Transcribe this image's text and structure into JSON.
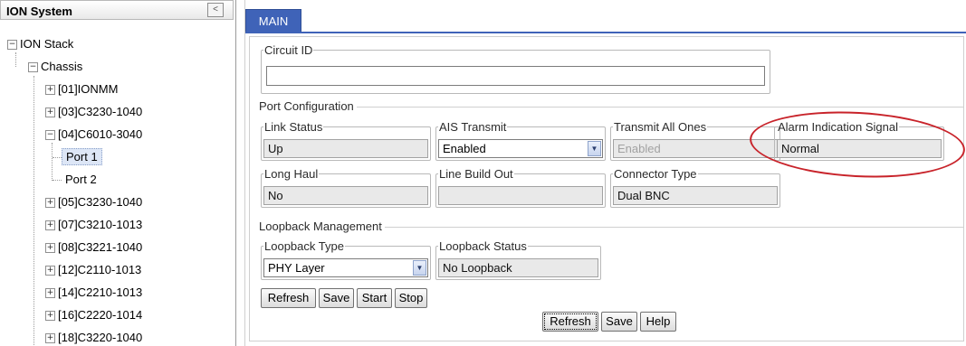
{
  "tree": {
    "title": "ION System",
    "collapse_glyph": "<",
    "root": "ION Stack",
    "chassis": "Chassis",
    "modules": [
      {
        "label": "[01]IONMM",
        "expander": "+"
      },
      {
        "label": "[03]C3230-1040",
        "expander": "+"
      },
      {
        "label": "[04]C6010-3040",
        "expander": "−"
      },
      {
        "label": "[05]C3230-1040",
        "expander": "+"
      },
      {
        "label": "[07]C3210-1013",
        "expander": "+"
      },
      {
        "label": "[08]C3221-1040",
        "expander": "+"
      },
      {
        "label": "[12]C2110-1013",
        "expander": "+"
      },
      {
        "label": "[14]C2210-1013",
        "expander": "+"
      },
      {
        "label": "[16]C2220-1014",
        "expander": "+"
      },
      {
        "label": "[18]C3220-1040",
        "expander": "+"
      }
    ],
    "ports": [
      "Port 1",
      "Port 2"
    ],
    "root_expander": "−",
    "chassis_expander": "−"
  },
  "tab": {
    "label": "MAIN"
  },
  "circuit": {
    "legend": "Circuit ID",
    "value": ""
  },
  "port_config": {
    "title": "Port Configuration",
    "link_status": {
      "legend": "Link Status",
      "value": "Up"
    },
    "ais_transmit": {
      "legend": "AIS Transmit",
      "value": "Enabled"
    },
    "transmit_all_ones": {
      "legend": "Transmit All Ones",
      "value": "Enabled"
    },
    "alarm_indication_signal": {
      "legend": "Alarm Indication Signal",
      "value": "Normal"
    },
    "long_haul": {
      "legend": "Long Haul",
      "value": "No"
    },
    "line_build_out": {
      "legend": "Line Build Out",
      "value": ""
    },
    "connector_type": {
      "legend": "Connector Type",
      "value": "Dual BNC"
    }
  },
  "loopback": {
    "title": "Loopback Management",
    "type": {
      "legend": "Loopback Type",
      "value": "PHY Layer"
    },
    "status": {
      "legend": "Loopback Status",
      "value": "No Loopback"
    },
    "buttons": {
      "refresh": "Refresh",
      "save": "Save",
      "start": "Start",
      "stop": "Stop"
    }
  },
  "bottom_buttons": {
    "refresh": "Refresh",
    "save": "Save",
    "help": "Help"
  },
  "icons": {
    "dropdown": "chevron-down-icon",
    "expand": "plus-box-icon",
    "collapse": "minus-box-icon"
  },
  "colors": {
    "tab_accent": "#3f63b8",
    "annotation": "#c8232a",
    "selection": "#dde6f6"
  }
}
